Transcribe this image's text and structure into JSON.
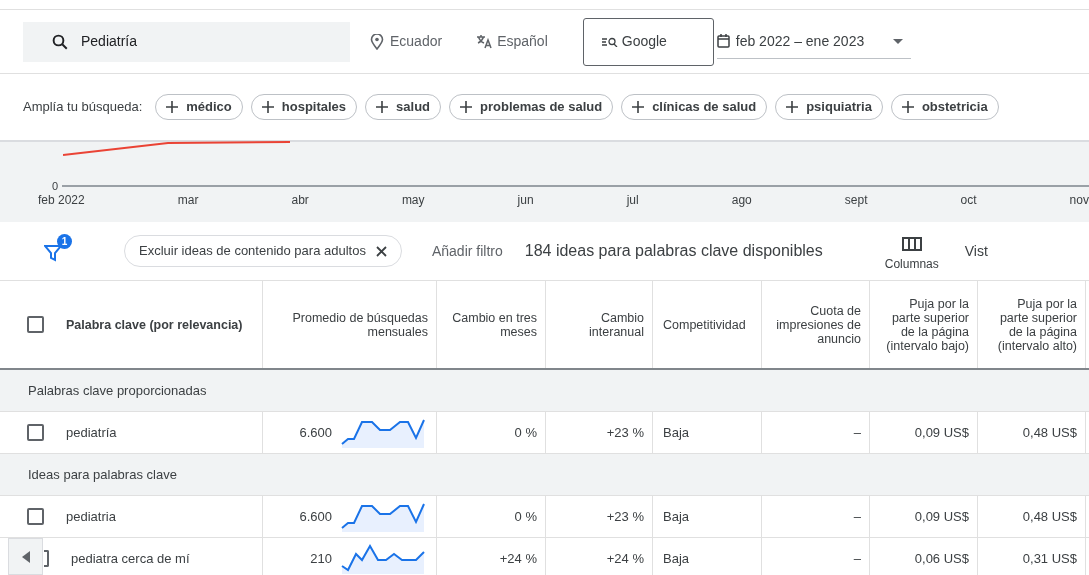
{
  "search": {
    "value": "Pediatría"
  },
  "location": "Ecuador",
  "language": "Español",
  "network": "Google",
  "date_range": "feb 2022 – ene 2023",
  "broaden": {
    "label": "Amplía tu búsqueda:",
    "chips": [
      "médico",
      "hospitales",
      "salud",
      "problemas de salud",
      "clínicas de salud",
      "psiquiatria",
      "obstetricia"
    ]
  },
  "trend_chart": {
    "y_tick": "0",
    "months": [
      "feb 2022",
      "mar",
      "abr",
      "may",
      "jun",
      "jul",
      "ago",
      "sept",
      "oct",
      "nov"
    ]
  },
  "toolbar": {
    "filter_count": "1",
    "filter_chip": "Excluir ideas de contenido para adultos",
    "add_filter": "Añadir filtro",
    "summary": "184 ideas para palabras clave disponibles",
    "columns": "Columnas",
    "view": "Vist"
  },
  "table": {
    "columns": [
      "Palabra clave (por relevancia)",
      "Promedio de búsquedas mensuales",
      "Cambio en tres meses",
      "Cambio interanual",
      "Competitividad",
      "Cuota de impresiones de anuncio",
      "Puja por la parte superior de la página (intervalo bajo)",
      "Puja por la parte superior de la página (intervalo alto)"
    ],
    "header_checked": false,
    "groups": [
      {
        "title": "Palabras clave proporcionadas",
        "rows": [
          {
            "keyword": "pediatría",
            "checked": false,
            "searches": "6.600",
            "kind": "steady",
            "three_month": "0 %",
            "yoy": "+23 %",
            "competition": "Baja",
            "share": "–",
            "bid_low": "0,09 US$",
            "bid_high": "0,48 US$"
          }
        ]
      },
      {
        "title": "Ideas para palabras clave",
        "rows": [
          {
            "keyword": "pediatria",
            "checked": false,
            "searches": "6.600",
            "kind": "steady",
            "three_month": "0 %",
            "yoy": "+23 %",
            "competition": "Baja",
            "share": "–",
            "bid_low": "0,09 US$",
            "bid_high": "0,48 US$"
          },
          {
            "keyword": "pediatra cerca de mí",
            "checked": false,
            "searches": "210",
            "kind": "spiky",
            "three_month": "+24 %",
            "yoy": "+24 %",
            "competition": "Baja",
            "share": "–",
            "bid_low": "0,06 US$",
            "bid_high": "0,31 US$"
          }
        ]
      }
    ]
  }
}
